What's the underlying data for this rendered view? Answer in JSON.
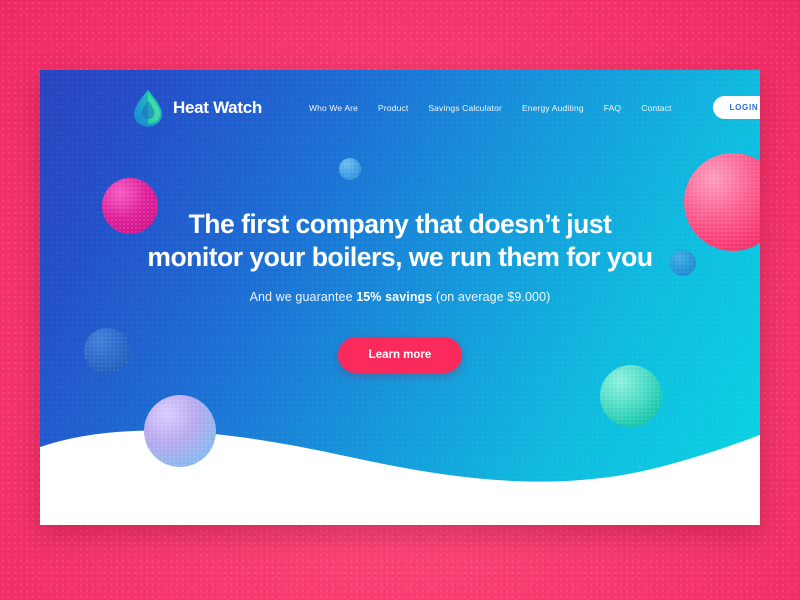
{
  "theme": {
    "backdrop_pink": "#f93e72",
    "cta_pink": "#fb2a5c",
    "hero_gradient_start": "#2a43bf",
    "hero_gradient_end": "#09d6e2",
    "login_text_blue": "#2a6fd0",
    "wave_white": "#ffffff"
  },
  "brand": {
    "name": "Heat Watch",
    "logo_icon": "water-droplet-icon"
  },
  "nav": {
    "items": [
      {
        "label": "Who We Are"
      },
      {
        "label": "Product"
      },
      {
        "label": "Savings Calculator"
      },
      {
        "label": "Energy Auditing"
      },
      {
        "label": "FAQ"
      },
      {
        "label": "Contact"
      }
    ],
    "login_label": "LOGIN"
  },
  "hero": {
    "headline_line1": "The first company that doesn’t just",
    "headline_line2": "monitor your boilers, we run them for you",
    "sub_prefix": "And we guarantee ",
    "sub_highlight": "15% savings",
    "sub_suffix": " (on average $9.000)",
    "cta_label": "Learn more"
  },
  "decor": {
    "spheres": [
      {
        "name": "sphere-magenta-left",
        "color": "#e0219b"
      },
      {
        "name": "sphere-pink-right",
        "color": "#fb3f78"
      },
      {
        "name": "sphere-lavender",
        "color": "#b9a9ee"
      },
      {
        "name": "sphere-teal",
        "color": "#3fd8c2"
      },
      {
        "name": "sphere-blue-small-top",
        "color": "#4aa8e8"
      },
      {
        "name": "sphere-blue-faint-left",
        "color": "#2f6fc9"
      },
      {
        "name": "sphere-blue-faint-right",
        "color": "#2a8ad8"
      }
    ]
  }
}
